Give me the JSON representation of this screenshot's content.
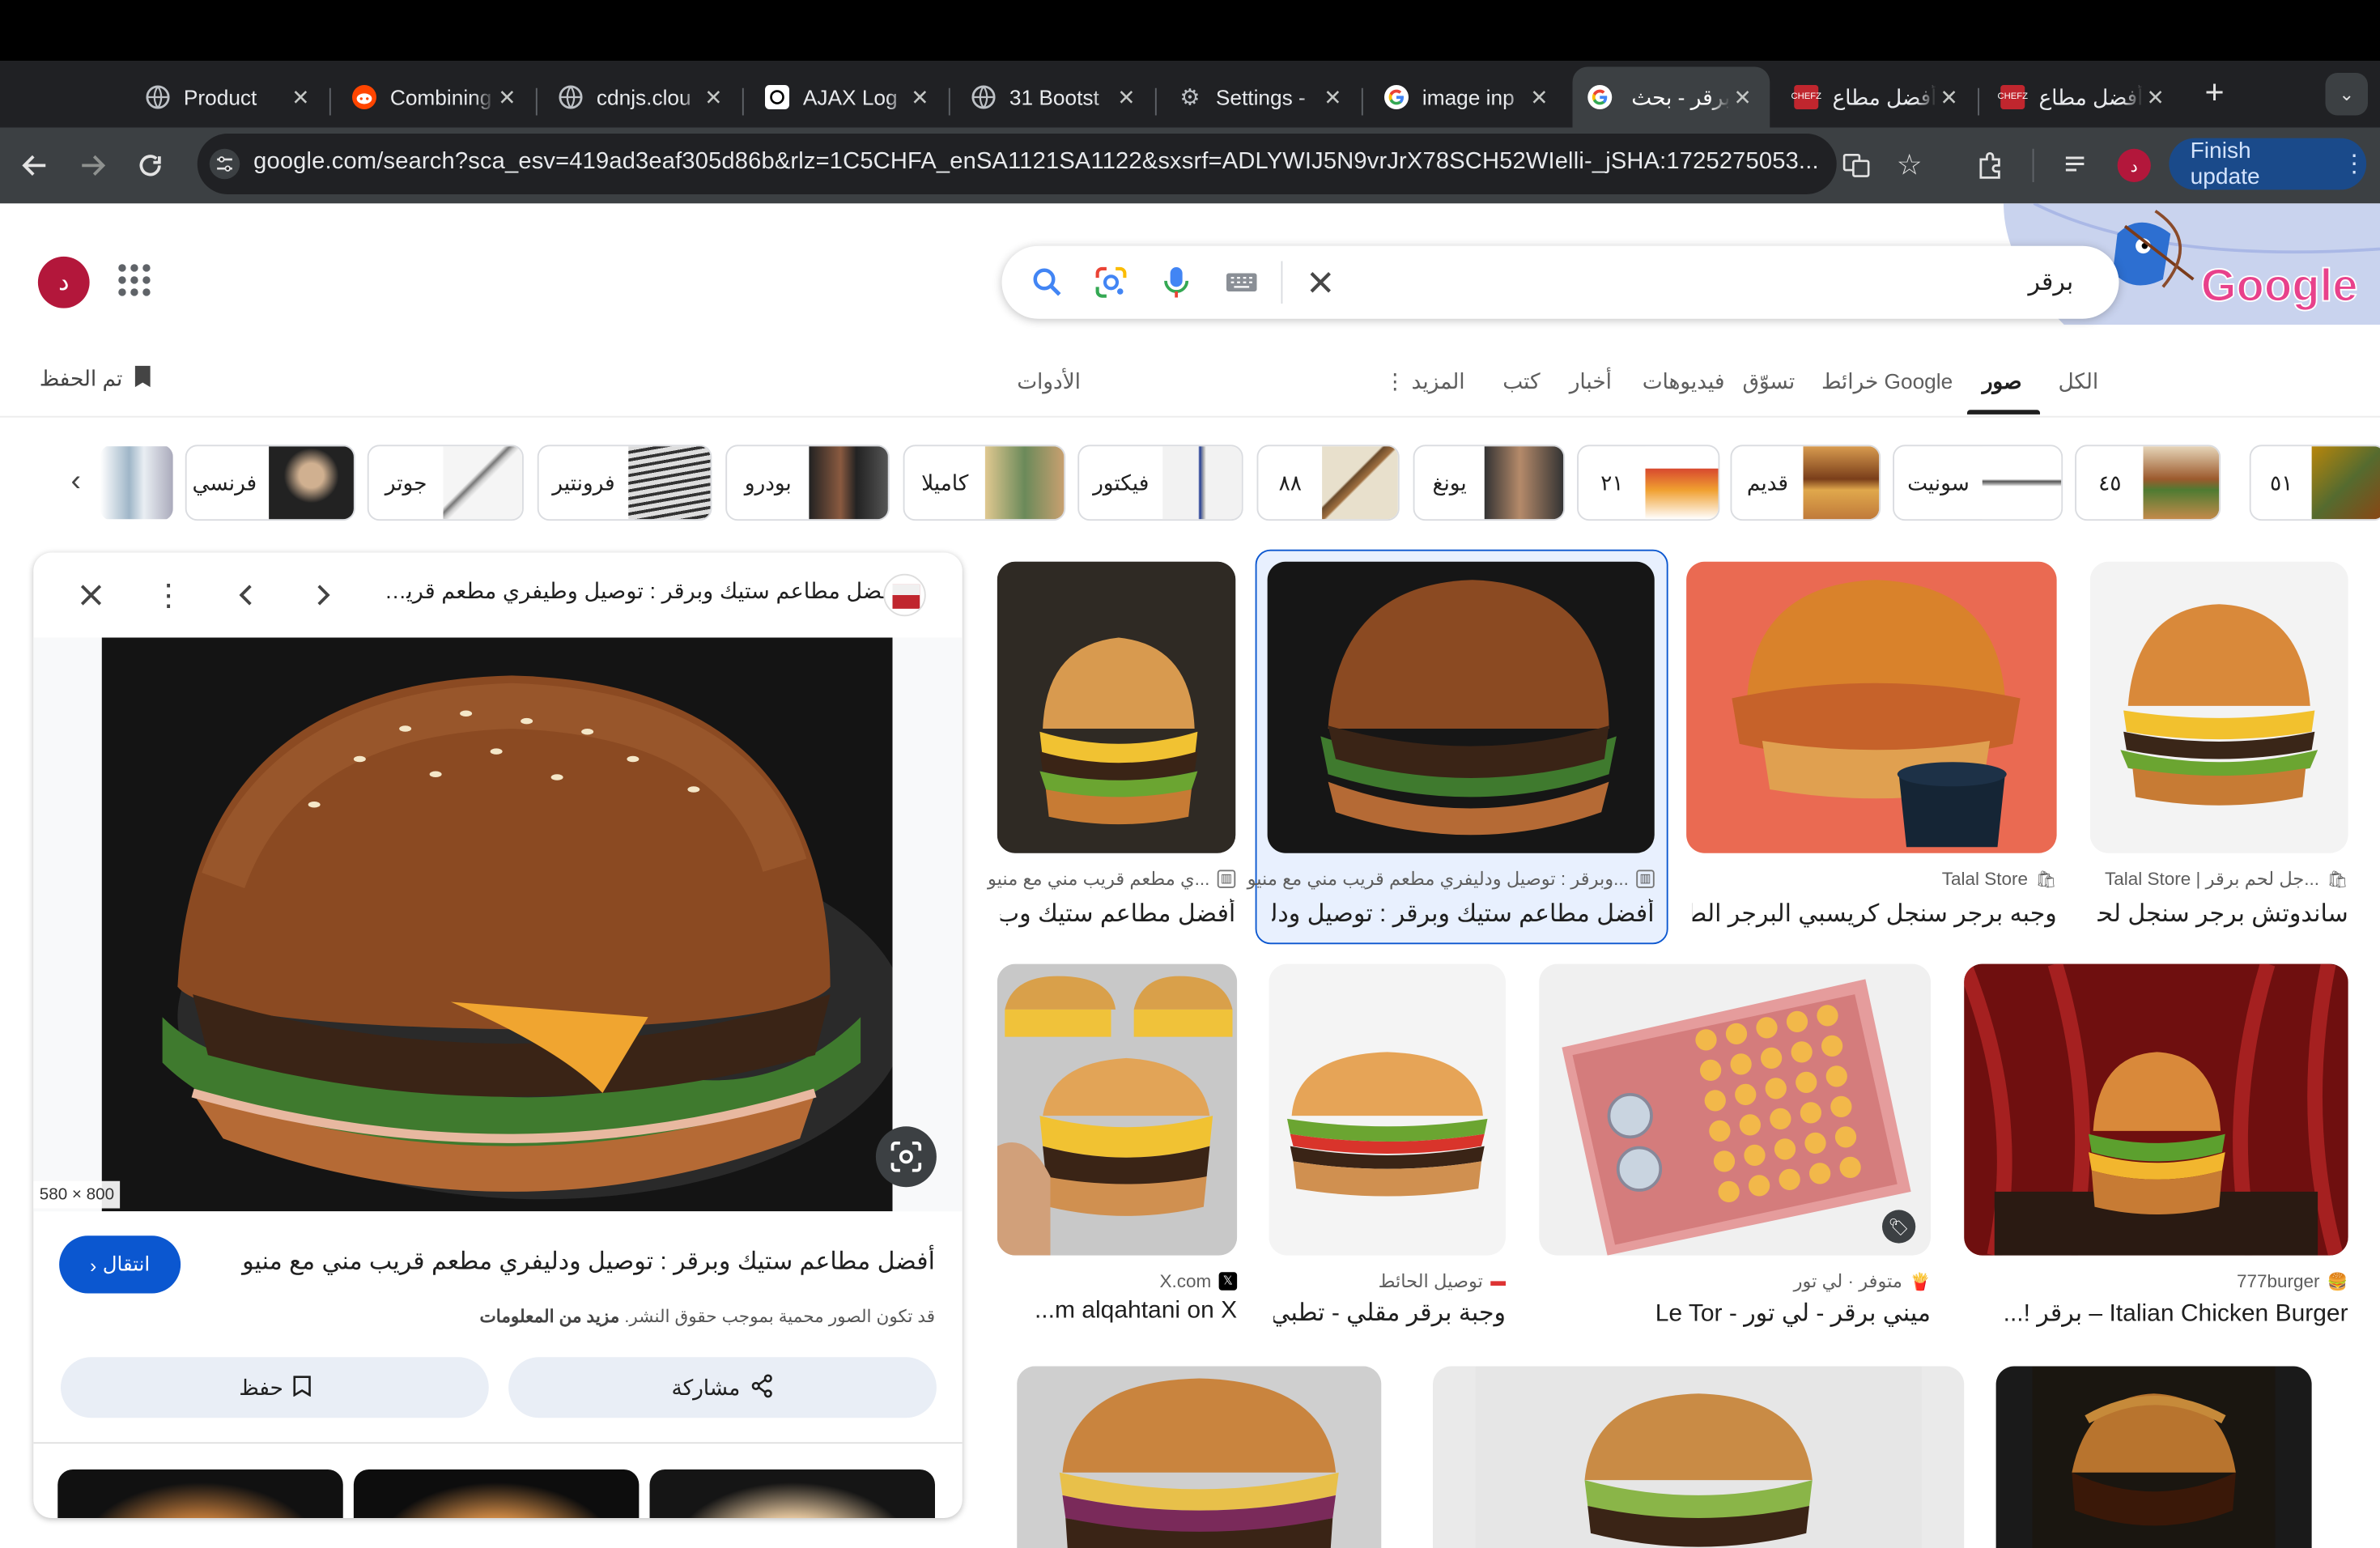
{
  "browser": {
    "tabs": [
      {
        "title": "Product",
        "icon": "globe-icon"
      },
      {
        "title": "Combining",
        "icon": "reddit-icon"
      },
      {
        "title": "cdnjs.clou",
        "icon": "globe-icon"
      },
      {
        "title": "AJAX Log",
        "icon": "openai-icon"
      },
      {
        "title": "31 Bootst",
        "icon": "globe-icon"
      },
      {
        "title": "Settings -",
        "icon": "gear-icon"
      },
      {
        "title": "image inp",
        "icon": "google-icon"
      },
      {
        "title": "برقر - بحث",
        "icon": "google-icon",
        "active": true
      },
      {
        "title": "أفضل مطاع",
        "icon": "chefz-icon"
      },
      {
        "title": "أفضل مطاع",
        "icon": "chefz-icon"
      }
    ],
    "url": "google.com/search?sca_esv=419ad3eaf305d86b&rlz=1C5CHFA_enSA1121SA1122&sxsrf=ADLYWIJ5N9vrJrX78SCH52WIelli-_jSHA:1725275053...",
    "profile_initial": "د",
    "finish_update": "Finish update"
  },
  "header": {
    "avatar_initial": "د",
    "search_query": "برقر",
    "logo_text": "Google"
  },
  "nav": {
    "tabs": [
      "الكل",
      "صور",
      "خرائط Google",
      "تسوّق",
      "فيديوهات",
      "أخبار",
      "كتب",
      "المزيد"
    ],
    "active": "صور",
    "tools": "الأدوات",
    "saved": "تم الحفظ"
  },
  "chips": [
    "٥١",
    "٤٥",
    "سونيت",
    "قديم",
    "٢١",
    "يونغ",
    "٨٨",
    "فيكتور",
    "كاميلا",
    "بودرو",
    "فرونتير",
    "جوتر",
    "فرنسي"
  ],
  "viewer": {
    "title": "أفضل مطاعم ستيك وبرقر : توصيل وطيفري مطعم قريب مني ...",
    "dimensions": "580 × 800",
    "caption": "أفضل مطاعم ستيك وبرقر : توصيل ودليفري مطعم قريب مني مع منيو",
    "visit_label": "انتقال",
    "copyright": "قد تكون الصور محمية بموجب حقوق النشر.",
    "learn_more": "مزيد من المعلومات",
    "share_label": "مشاركة",
    "save_label": "حفظ"
  },
  "results": [
    {
      "source": "...جل لحم برقر | Talal Store",
      "caption": "ساندوتش برجر سنجل لحـ..."
    },
    {
      "source": "Talal Store",
      "caption": "وجبه برجر سنجل كريسبي البرجر الط..."
    },
    {
      "source": "...وبرقر : توصيل ودليفري مطعم قريب مني مع منيو",
      "caption": "أفضل مطاعم ستيك وبرقر : توصيل ودلي...",
      "selected": true
    },
    {
      "source": "...ي مطعم قريب مني مع منيو",
      "caption": "أفضل مطاعم ستيك وب..."
    },
    {
      "source": "777burger",
      "caption": "Italian Chicken Burger – برقر !..."
    },
    {
      "source": "متوفر · لي تور",
      "caption": "ميني برقر - لي تور - Le Tor"
    },
    {
      "source": "توصيل الحائط",
      "caption": "وجبة برقر مقلي - تطبي..."
    },
    {
      "source": "X.com",
      "caption": "m alqahtani on X..."
    }
  ],
  "colors": {
    "accent": "#0b57d0",
    "avatar": "#b3173b",
    "chrome_dark": "#202124",
    "toolbar": "#3c4043"
  }
}
